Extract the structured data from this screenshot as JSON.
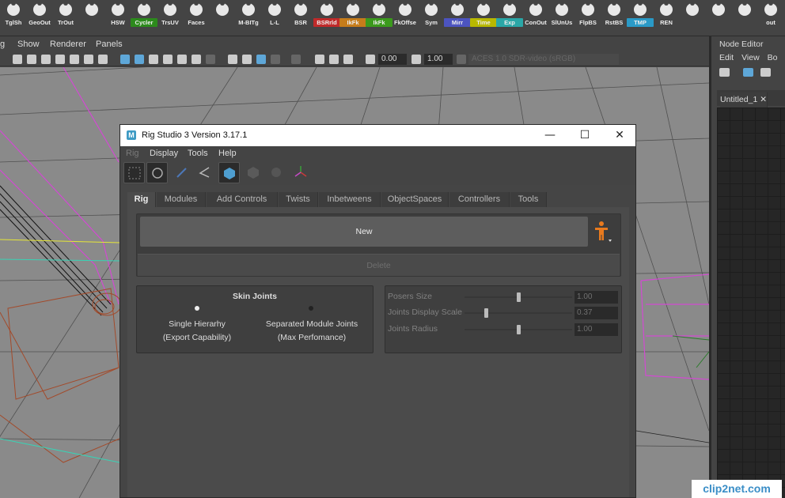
{
  "shelf": {
    "buttons": [
      {
        "label": "TglSh",
        "color": "#444444"
      },
      {
        "label": "GeoOut",
        "color": "#444444"
      },
      {
        "label": "TrOut",
        "color": "#444444"
      },
      {
        "label": "",
        "color": "#444444"
      },
      {
        "label": "HSW",
        "color": "#444444"
      },
      {
        "label": "Cycler",
        "color": "#2c8a1c"
      },
      {
        "label": "TrsUV",
        "color": "#444444"
      },
      {
        "label": "Faces",
        "color": "#444444"
      },
      {
        "label": "",
        "color": "#444444"
      },
      {
        "label": "M-BITg",
        "color": "#444444"
      },
      {
        "label": "L-L",
        "color": "#444444"
      },
      {
        "label": "BSR",
        "color": "#444444"
      },
      {
        "label": "BSRrld",
        "color": "#c02a2a"
      },
      {
        "label": "IkFk",
        "color": "#c67c1a"
      },
      {
        "label": "IkFk",
        "color": "#3b9a1c"
      },
      {
        "label": "FkOffse",
        "color": "#444444"
      },
      {
        "label": "Sym",
        "color": "#444444"
      },
      {
        "label": "Mirr",
        "color": "#4c54c0"
      },
      {
        "label": "Time",
        "color": "#b8b800"
      },
      {
        "label": "Exp",
        "color": "#2aa7a7"
      },
      {
        "label": "ConOut",
        "color": "#444444"
      },
      {
        "label": "SlUnUs",
        "color": "#444444"
      },
      {
        "label": "FlpBS",
        "color": "#444444"
      },
      {
        "label": "RstBS",
        "color": "#444444"
      },
      {
        "label": "TMP",
        "color": "#2a9ac7"
      },
      {
        "label": "REN",
        "color": "#444444"
      },
      {
        "label": "",
        "color": "#444444"
      },
      {
        "label": "",
        "color": "#444444"
      },
      {
        "label": "",
        "color": "#444444"
      },
      {
        "label": "out",
        "color": "#444444"
      }
    ]
  },
  "viewport": {
    "menu": [
      "g",
      "Show",
      "Renderer",
      "Panels"
    ],
    "field1": "0.00",
    "field2": "1.00",
    "color_space": "ACES 1.0 SDR-video (sRGB)"
  },
  "node_editor": {
    "title": "Node Editor",
    "menu": [
      "Edit",
      "View",
      "Bo"
    ],
    "tab": "Untitled_1",
    "tab_close": "✕"
  },
  "rig_window": {
    "title": "Rig Studio 3 Version 3.17.1",
    "minimize": "—",
    "maximize": "☐",
    "close": "✕",
    "menu": [
      "Rig",
      "Display",
      "Tools",
      "Help"
    ],
    "tabs": [
      "Rig",
      "Modules",
      "Add Controls",
      "Twists",
      "Inbetweens",
      "ObjectSpaces",
      "Controllers",
      "Tools"
    ],
    "active_tab": "Rig",
    "new_button": "New",
    "delete_button": "Delete",
    "skin_joints": {
      "title": "Skin Joints",
      "options": [
        {
          "line1": "Single Hierarhy",
          "line2": "(Export Capability)",
          "selected": true
        },
        {
          "line1": "Separated Module Joints",
          "line2": "(Max Perfomance)",
          "selected": false
        }
      ]
    },
    "sliders": [
      {
        "label": "Posers Size",
        "value": "1.00",
        "level": 0.5
      },
      {
        "label": "Joints Display Scale",
        "value": "0.37",
        "level": 0.2
      },
      {
        "label": "Joints Radius",
        "value": "1.00",
        "level": 0.5
      }
    ]
  },
  "watermark": "clip2net.com",
  "colors": {
    "accent": "#e87a1e",
    "viewport_bg": "#8a8a8a"
  }
}
